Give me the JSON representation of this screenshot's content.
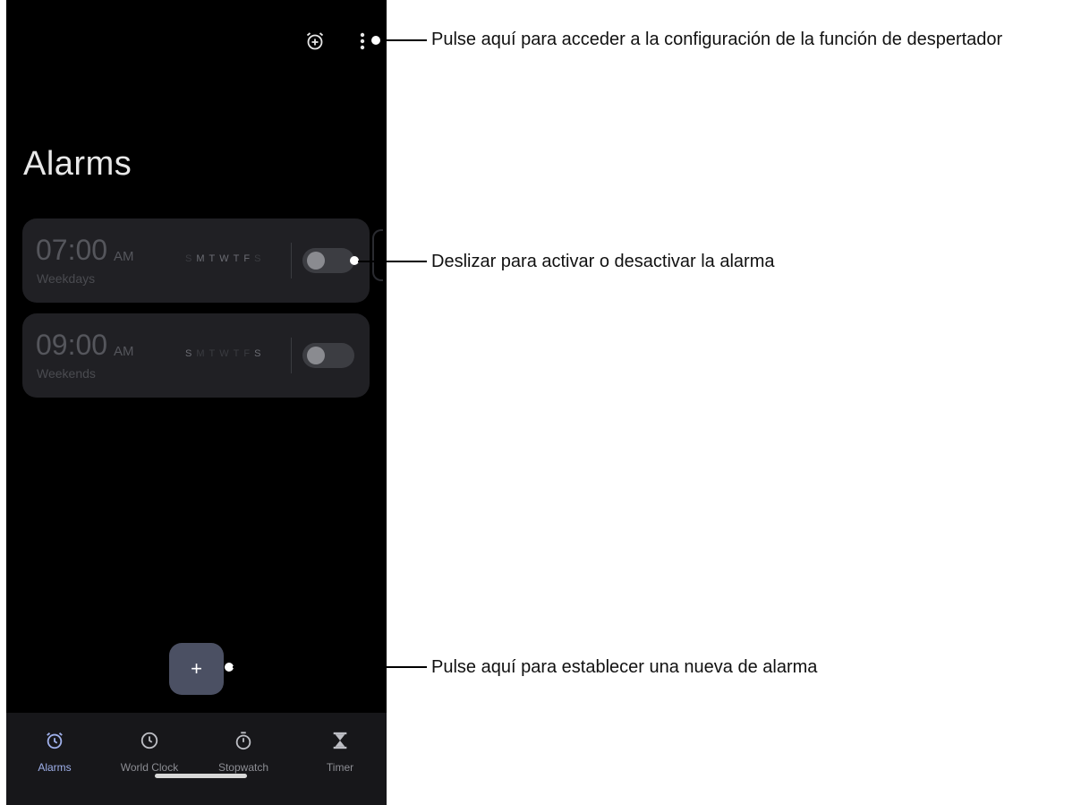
{
  "screen": {
    "title": "Alarms",
    "top_actions": [
      {
        "icon": "alarm-add-icon"
      },
      {
        "icon": "more-vertical-icon"
      }
    ],
    "alarms": [
      {
        "time": "07:00",
        "ampm": "AM",
        "label": "Weekdays",
        "days": [
          "S",
          "M",
          "T",
          "W",
          "T",
          "F",
          "S"
        ],
        "active_days": [
          false,
          true,
          true,
          true,
          true,
          true,
          false
        ],
        "enabled": false
      },
      {
        "time": "09:00",
        "ampm": "AM",
        "label": "Weekends",
        "days": [
          "S",
          "M",
          "T",
          "W",
          "T",
          "F",
          "S"
        ],
        "active_days": [
          true,
          false,
          false,
          false,
          false,
          false,
          true
        ],
        "enabled": false
      }
    ],
    "fab": {
      "label": "+",
      "icon": "plus-icon"
    },
    "nav": [
      {
        "label": "Alarms",
        "icon": "alarm-clock-icon",
        "active": true
      },
      {
        "label": "World Clock",
        "icon": "clock-icon",
        "active": false
      },
      {
        "label": "Stopwatch",
        "icon": "stopwatch-icon",
        "active": false
      },
      {
        "label": "Timer",
        "icon": "hourglass-icon",
        "active": false
      }
    ]
  },
  "callouts": [
    {
      "text": "Pulse aquí para acceder a la configuración de la función de despertador"
    },
    {
      "text": "Deslizar para activar o desactivar la alarma"
    },
    {
      "text": "Pulse aquí para establecer una nueva de alarma"
    }
  ],
  "colors": {
    "background": "#000000",
    "card": "#202024",
    "nav_active": "#9fb0ea",
    "fab": "#4b5063"
  }
}
